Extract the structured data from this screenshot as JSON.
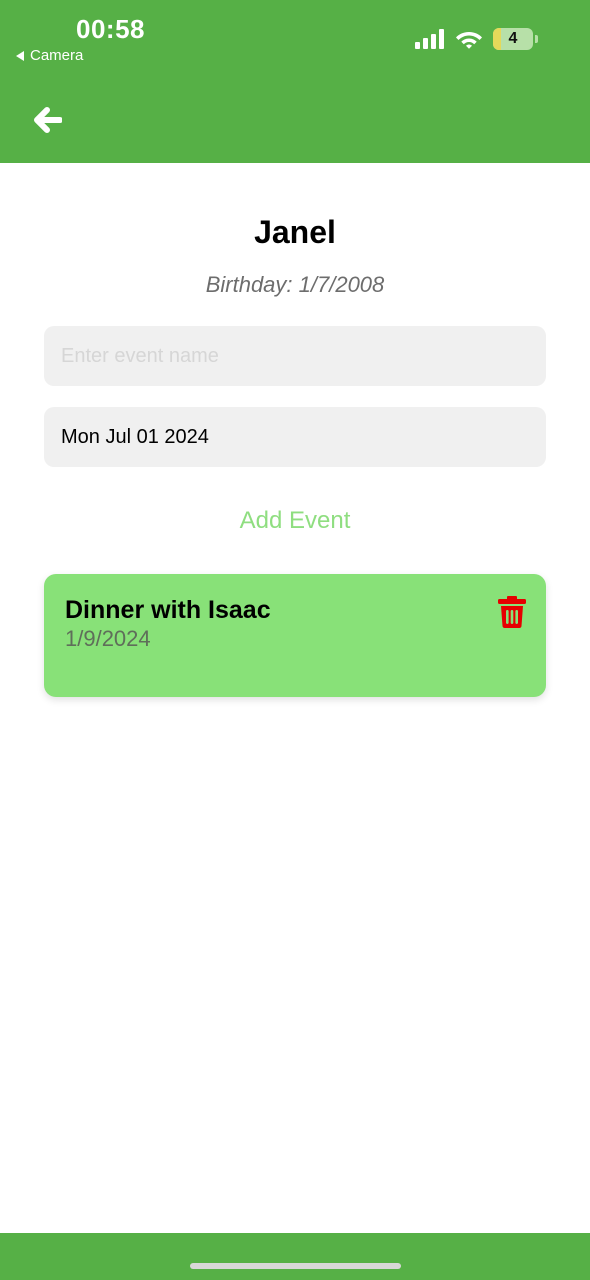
{
  "status_bar": {
    "time": "00:58",
    "back_app": "Camera",
    "battery_level": "4"
  },
  "header": {
    "back_icon": "arrow-left-icon",
    "color": "#56b046"
  },
  "person": {
    "name": "Janel",
    "birthday": "Birthday: 1/7/2008"
  },
  "form": {
    "event_name_placeholder": "Enter event name",
    "event_name_value": "",
    "date_value": "Mon Jul 01 2024",
    "add_event_label": "Add Event"
  },
  "events": [
    {
      "title": "Dinner with Isaac",
      "date": "1/9/2024",
      "delete_icon": "trash-icon"
    }
  ],
  "colors": {
    "accent": "#56b046",
    "card": "#88e178",
    "delete": "#e60000",
    "add_event": "#8fde80"
  }
}
